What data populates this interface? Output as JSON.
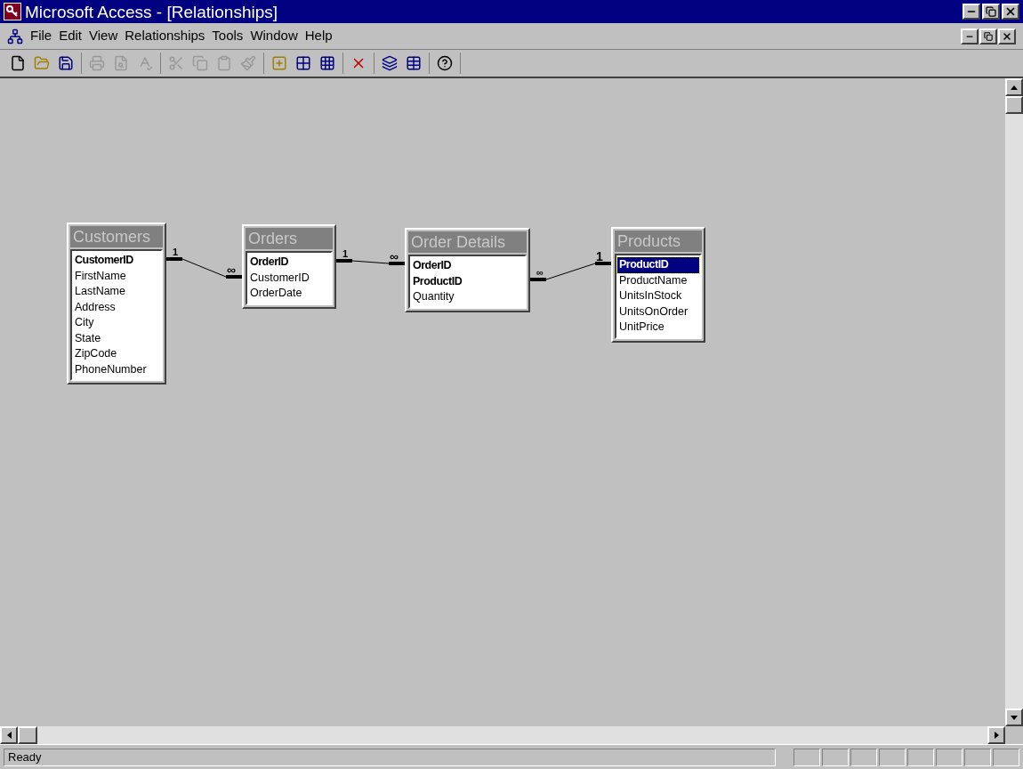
{
  "window": {
    "title": "Microsoft Access - [Relationships]"
  },
  "menu": [
    "File",
    "Edit",
    "View",
    "Relationships",
    "Tools",
    "Window",
    "Help"
  ],
  "toolbar": [
    [
      {
        "kind": "new",
        "disabled": false
      },
      {
        "kind": "open",
        "disabled": false
      },
      {
        "kind": "save",
        "disabled": false
      }
    ],
    [
      {
        "kind": "print",
        "disabled": true
      },
      {
        "kind": "preview",
        "disabled": true
      },
      {
        "kind": "spelling",
        "disabled": true
      }
    ],
    [
      {
        "kind": "cut",
        "disabled": true
      },
      {
        "kind": "copy",
        "disabled": true
      },
      {
        "kind": "paste",
        "disabled": true
      },
      {
        "kind": "format-painter",
        "disabled": true
      }
    ],
    [
      {
        "kind": "show-table",
        "disabled": false
      },
      {
        "kind": "direct",
        "disabled": false
      },
      {
        "kind": "all",
        "disabled": false
      }
    ],
    [
      {
        "kind": "delete",
        "disabled": false
      }
    ],
    [
      {
        "kind": "database-window",
        "disabled": false
      },
      {
        "kind": "new-object",
        "disabled": false
      }
    ],
    [
      {
        "kind": "help",
        "disabled": false
      }
    ]
  ],
  "tables": [
    {
      "name": "Customers",
      "fields": [
        {
          "name": "CustomerID",
          "key": true,
          "selected": false
        },
        {
          "name": "FirstName",
          "key": false,
          "selected": false
        },
        {
          "name": "LastName",
          "key": false,
          "selected": false
        },
        {
          "name": "Address",
          "key": false,
          "selected": false
        },
        {
          "name": "City",
          "key": false,
          "selected": false
        },
        {
          "name": "State",
          "key": false,
          "selected": false
        },
        {
          "name": "ZipCode",
          "key": false,
          "selected": false
        },
        {
          "name": "PhoneNumber",
          "key": false,
          "selected": false
        }
      ]
    },
    {
      "name": "Orders",
      "fields": [
        {
          "name": "OrderID",
          "key": true,
          "selected": false
        },
        {
          "name": "CustomerID",
          "key": false,
          "selected": false
        },
        {
          "name": "OrderDate",
          "key": false,
          "selected": false
        }
      ]
    },
    {
      "name": "Order Details",
      "fields": [
        {
          "name": "OrderID",
          "key": true,
          "selected": false
        },
        {
          "name": "ProductID",
          "key": true,
          "selected": false
        },
        {
          "name": "Quantity",
          "key": false,
          "selected": false
        }
      ]
    },
    {
      "name": "Products",
      "fields": [
        {
          "name": "ProductID",
          "key": true,
          "selected": true
        },
        {
          "name": "ProductName",
          "key": false,
          "selected": false
        },
        {
          "name": "UnitsInStock",
          "key": false,
          "selected": false
        },
        {
          "name": "UnitsOnOrder",
          "key": false,
          "selected": false
        },
        {
          "name": "UnitPrice",
          "key": false,
          "selected": false
        }
      ]
    }
  ],
  "relationships": [
    {
      "one_label": "1",
      "many_label": "∞"
    },
    {
      "one_label": "1",
      "many_label": "∞"
    },
    {
      "many_label": "∞",
      "one_label": "1"
    }
  ],
  "status_bar": {
    "text": "Ready"
  }
}
